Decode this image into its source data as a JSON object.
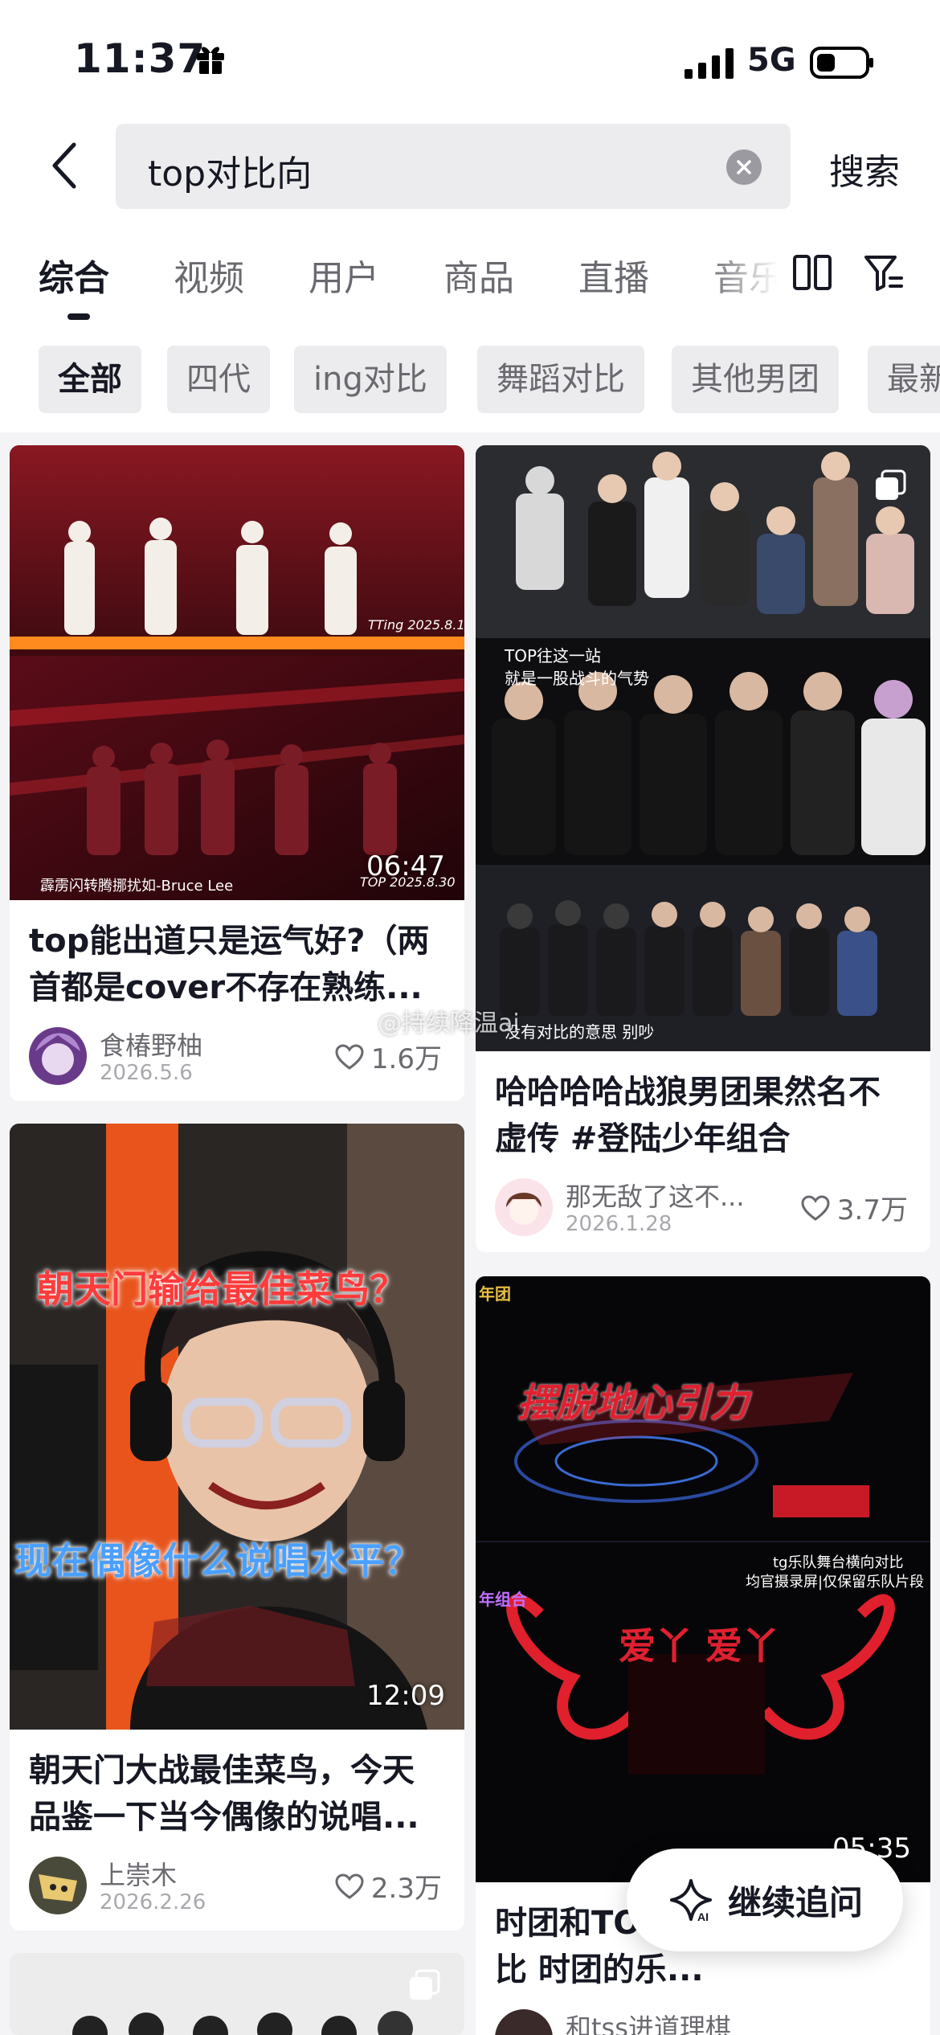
{
  "status_bar": {
    "time": "11:37",
    "network": "5G"
  },
  "search": {
    "query": "top对比向",
    "submit_label": "搜索"
  },
  "tabs": [
    {
      "label": "综合",
      "active": true
    },
    {
      "label": "视频"
    },
    {
      "label": "用户"
    },
    {
      "label": "商品"
    },
    {
      "label": "直播"
    },
    {
      "label": "音乐"
    }
  ],
  "chips": [
    {
      "label": "全部",
      "active": true
    },
    {
      "label": "四代"
    },
    {
      "label": "ing对比"
    },
    {
      "label": "舞蹈对比"
    },
    {
      "label": "其他男团"
    },
    {
      "label": "最新"
    }
  ],
  "cards": [
    {
      "title": "top能出道只是运气好?（两首都是cover不存在熟练...",
      "duration": "06:47",
      "author": "食椿野柚",
      "date": "2026.5.6",
      "likes": "1.6万",
      "overlay": {
        "top_caption": "TTing 2025.8.1",
        "bottom_caption": "TOP 2025.8.30",
        "credit": "霹雳闪转腾挪扰如-Bruce Lee"
      }
    },
    {
      "title": "哈哈哈哈战狼男团果然名不虚传 #登陆少年组合",
      "author": "那无敌了这不...",
      "date": "2026.1.28",
      "likes": "3.7万",
      "overlay": {
        "caption_1": "TOP往这一站",
        "caption_2": "就是一股战斗的气势",
        "caption_3": "没有对比的意思 别吵"
      }
    },
    {
      "title": "朝天门大战最佳菜鸟，今天品鉴一下当今偶像的说唱...",
      "duration": "12:09",
      "author": "上崇木",
      "date": "2026.2.26",
      "likes": "2.3万",
      "overlay": {
        "headline_1": "朝天门输给最佳菜鸟？",
        "headline_2": "现在偶像什么说唱水平？"
      }
    },
    {
      "title": "时团和TOP...可投稿舞台对比 时团的乐...",
      "duration": "05:35",
      "author": "和tss进道理棋",
      "overlay": {
        "tag_1": "年团",
        "tag_2": "年组合",
        "headline": "摆脱地心引力",
        "note_1": "tg乐队舞台横向对比",
        "note_2": "均官摄录屏|仅保留乐队片段",
        "song": "爱丫 爱丫"
      }
    }
  ],
  "watermark": "@持续降温ai",
  "ai_button": {
    "label": "继续追问"
  },
  "colors": {
    "background": "#f4f4f6",
    "accent_red": "#e8202e",
    "text_primary": "#161823",
    "text_secondary": "#69696f"
  },
  "icons": [
    "gift-icon",
    "signal-icon",
    "battery-icon",
    "back-icon",
    "clear-icon",
    "layout-icon",
    "filter-icon",
    "heart-icon",
    "multi-image-icon",
    "ai-sparkle-icon"
  ]
}
